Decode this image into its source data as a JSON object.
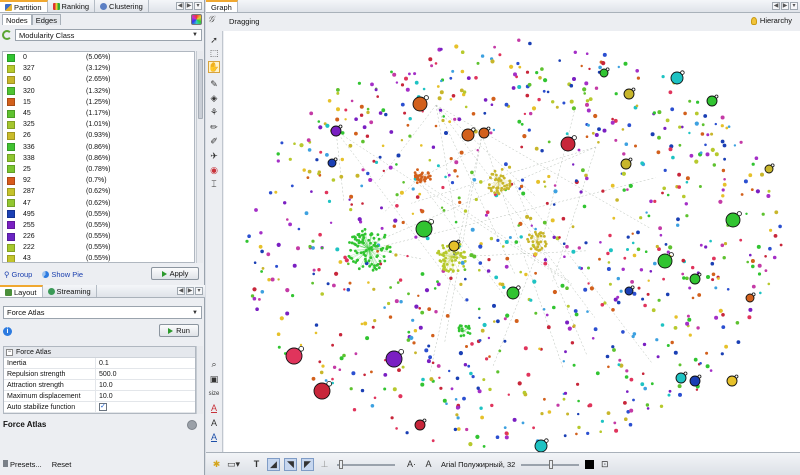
{
  "left_tabs": [
    {
      "label": "Partition",
      "icon": "partition-icon",
      "active": true
    },
    {
      "label": "Ranking",
      "icon": "ranking-icon",
      "active": false
    },
    {
      "label": "Clustering",
      "icon": "clustering-icon",
      "active": false
    }
  ],
  "partition": {
    "subtabs": [
      "Nodes",
      "Edges"
    ],
    "attribute": "Modularity Class",
    "rows": [
      {
        "id": "0",
        "pct": "(5.06%)",
        "color": "#31c431"
      },
      {
        "id": "327",
        "pct": "(3.12%)",
        "color": "#b7c92d"
      },
      {
        "id": "60",
        "pct": "(2.65%)",
        "color": "#c8b62b"
      },
      {
        "id": "320",
        "pct": "(1.32%)",
        "color": "#4fc433"
      },
      {
        "id": "15",
        "pct": "(1.25%)",
        "color": "#d2601c"
      },
      {
        "id": "45",
        "pct": "(1.17%)",
        "color": "#5ec22f"
      },
      {
        "id": "325",
        "pct": "(1.01%)",
        "color": "#a4c62d"
      },
      {
        "id": "26",
        "pct": "(0.93%)",
        "color": "#c9bb2a"
      },
      {
        "id": "336",
        "pct": "(0.86%)",
        "color": "#41c232"
      },
      {
        "id": "338",
        "pct": "(0.86%)",
        "color": "#8fc630"
      },
      {
        "id": "25",
        "pct": "(0.78%)",
        "color": "#7ac530"
      },
      {
        "id": "92",
        "pct": "(0.7%)",
        "color": "#d85a1c"
      },
      {
        "id": "287",
        "pct": "(0.62%)",
        "color": "#c5c32b"
      },
      {
        "id": "47",
        "pct": "(0.62%)",
        "color": "#92c730"
      },
      {
        "id": "495",
        "pct": "(0.55%)",
        "color": "#1a3fb4"
      },
      {
        "id": "255",
        "pct": "(0.55%)",
        "color": "#7a1fc2"
      },
      {
        "id": "226",
        "pct": "(0.55%)",
        "color": "#6a24c4"
      },
      {
        "id": "222",
        "pct": "(0.55%)",
        "color": "#a6c82d"
      },
      {
        "id": "43",
        "pct": "(0.55%)",
        "color": "#c3c52b"
      }
    ],
    "group_label": "Group",
    "show_pie_label": "Show Pie",
    "apply_label": "Apply"
  },
  "layout_tabs": [
    {
      "label": "Layout",
      "active": true
    },
    {
      "label": "Streaming",
      "active": false
    }
  ],
  "layout": {
    "algorithm": "Force Atlas",
    "run_label": "Run",
    "section": "Force Atlas",
    "properties": [
      {
        "name": "Inertia",
        "value": "0.1"
      },
      {
        "name": "Repulsion strength",
        "value": "500.0"
      },
      {
        "name": "Attraction strength",
        "value": "10.0"
      },
      {
        "name": "Maximum displacement",
        "value": "10.0"
      },
      {
        "name": "Auto stabilize function",
        "value": "✓"
      }
    ],
    "footer_title": "Force Atlas",
    "presets_label": "Presets...",
    "reset_label": "Reset"
  },
  "graph": {
    "tab": "Graph",
    "mode": "Dragging",
    "hierarchy_label": "Hierarchy",
    "font_label": "Arial Полужирный, 32",
    "size_label": "size"
  }
}
